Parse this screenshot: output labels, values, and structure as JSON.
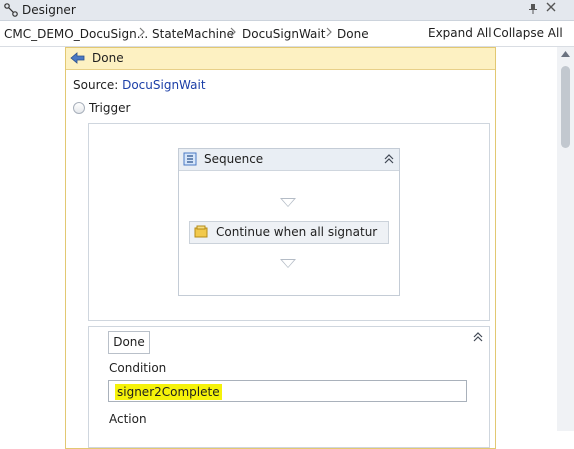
{
  "window": {
    "title": "Designer",
    "pin_glyph": "⎕",
    "close_glyph": "✕"
  },
  "breadcrumb": {
    "items": [
      "CMC_DEMO_DocuSign...",
      "StateMachine",
      "DocuSignWait",
      "Done"
    ],
    "separator": ">",
    "expand_all": "Expand All",
    "collapse_all": "Collapse All"
  },
  "state": {
    "title": "Done",
    "source_label": "Source:",
    "source_value": "DocuSignWait",
    "trigger_label": "Trigger"
  },
  "sequence": {
    "title": "Sequence",
    "collapse_glyph": "˄",
    "activity_label": "Continue when all signatur"
  },
  "transition": {
    "tab_label": "Done",
    "condition_label": "Condition",
    "condition_value": "signer2Complete",
    "action_label": "Action"
  },
  "colors": {
    "state_header_bg": "#fdf1c2",
    "state_border": "#e2c872",
    "link": "#1b3ea7",
    "highlight": "#f5f20a"
  },
  "icons": {
    "title": "state-machine-icon",
    "state": "state-icon",
    "sequence": "sequence-icon",
    "activity": "activity-icon"
  }
}
